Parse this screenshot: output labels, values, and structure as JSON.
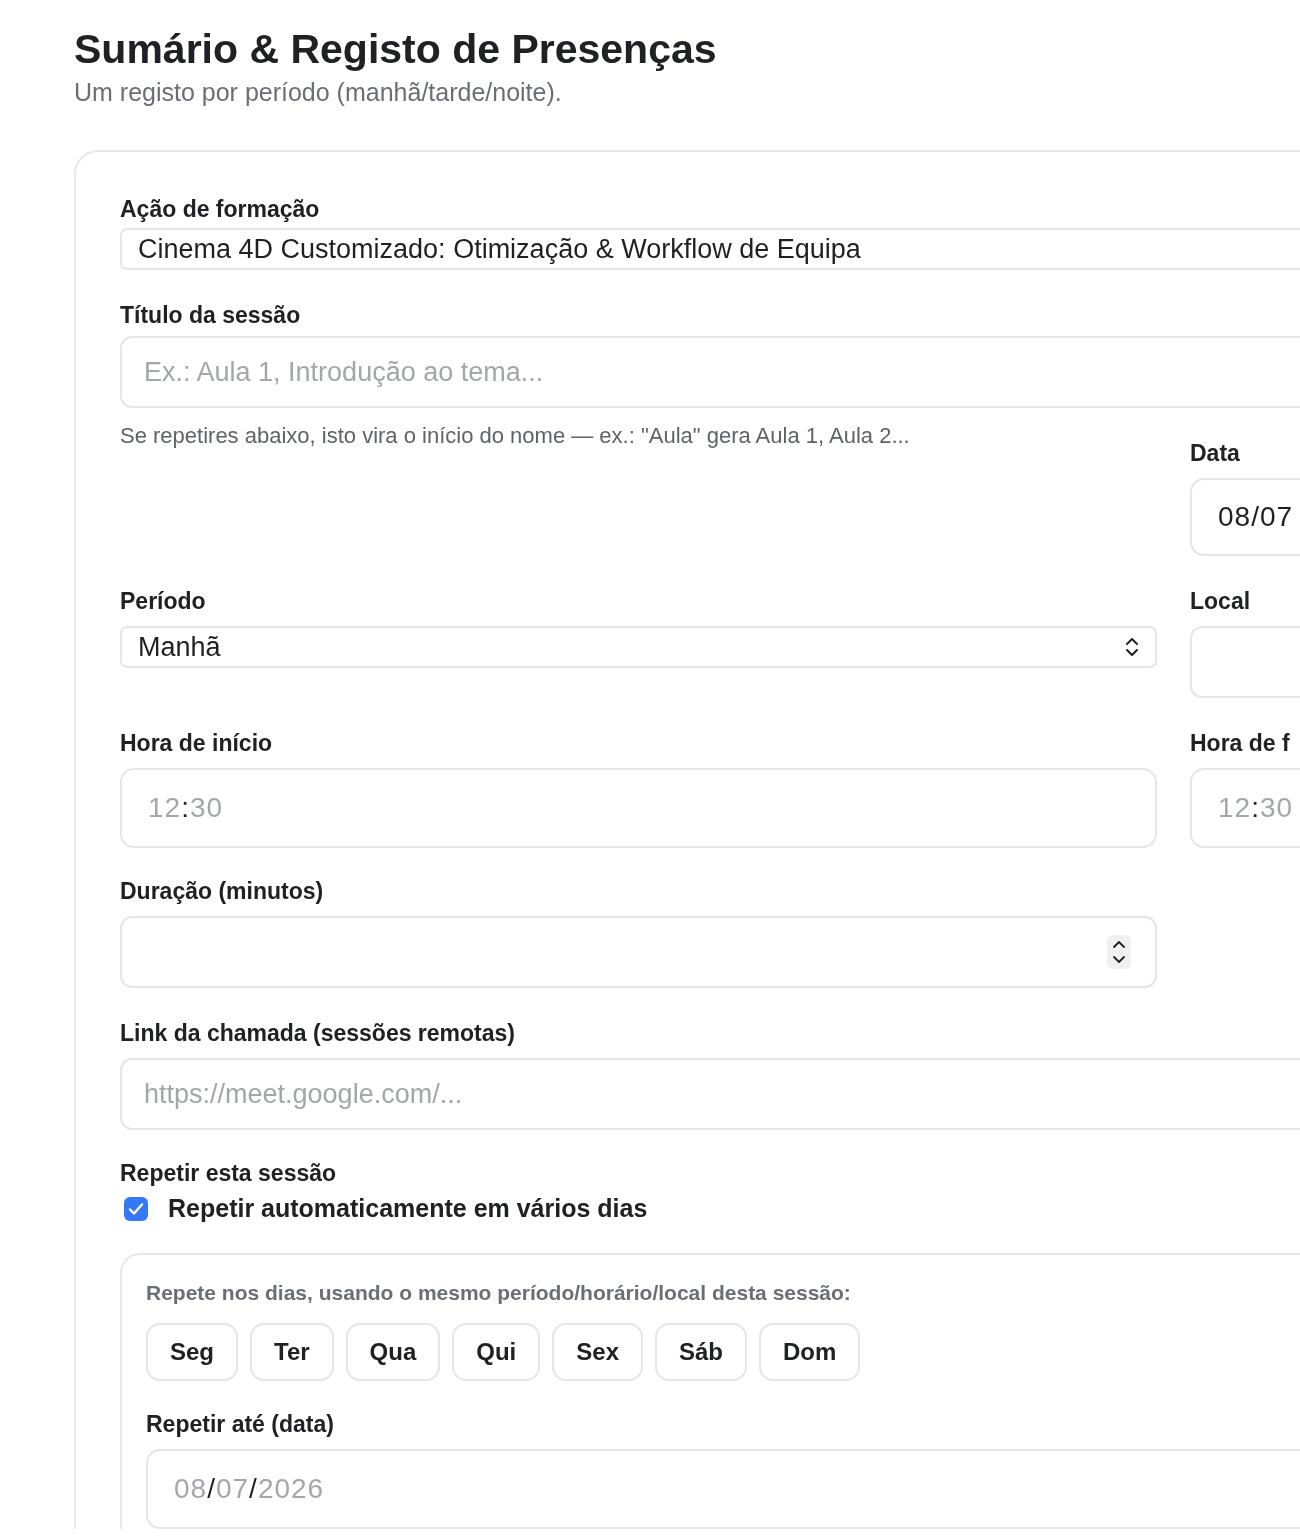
{
  "header": {
    "title": "Sumário & Registo de Presenças",
    "subtitle": "Um registo por período (manhã/tarde/noite)."
  },
  "form": {
    "training_action": {
      "label": "Ação de formação",
      "value": "Cinema 4D Customizado: Otimização & Workflow de Equipa"
    },
    "session_title": {
      "label": "Título da sessão",
      "placeholder": "Ex.: Aula 1, Introdução ao tema...",
      "hint": "Se repetires abaixo, isto vira o início do nome — ex.: \"Aula\" gera Aula 1, Aula 2..."
    },
    "date": {
      "label": "Data",
      "value": "08/07"
    },
    "period": {
      "label": "Período",
      "value": "Manhã"
    },
    "location": {
      "label": "Local"
    },
    "start_time": {
      "label": "Hora de início",
      "placeholder": "12:30"
    },
    "end_time": {
      "label": "Hora de f",
      "placeholder": "12:30"
    },
    "duration": {
      "label": "Duração (minutos)"
    },
    "call_link": {
      "label": "Link da chamada (sessões remotas)",
      "placeholder": "https://meet.google.com/..."
    },
    "repeat": {
      "label": "Repetir esta sessão",
      "checkbox": {
        "label": "Repetir automaticamente em vários dias",
        "checked": true
      },
      "panel": {
        "instructions": "Repete nos dias, usando o mesmo período/horário/local desta sessão:",
        "days": [
          {
            "label": "Seg",
            "selected": false
          },
          {
            "label": "Ter",
            "selected": false
          },
          {
            "label": "Qua",
            "selected": false
          },
          {
            "label": "Qui",
            "selected": false
          },
          {
            "label": "Sex",
            "selected": false
          },
          {
            "label": "Sáb",
            "selected": false
          },
          {
            "label": "Dom",
            "selected": false
          }
        ],
        "until": {
          "label": "Repetir até (data)",
          "placeholder": "08/07/2026"
        }
      }
    }
  }
}
